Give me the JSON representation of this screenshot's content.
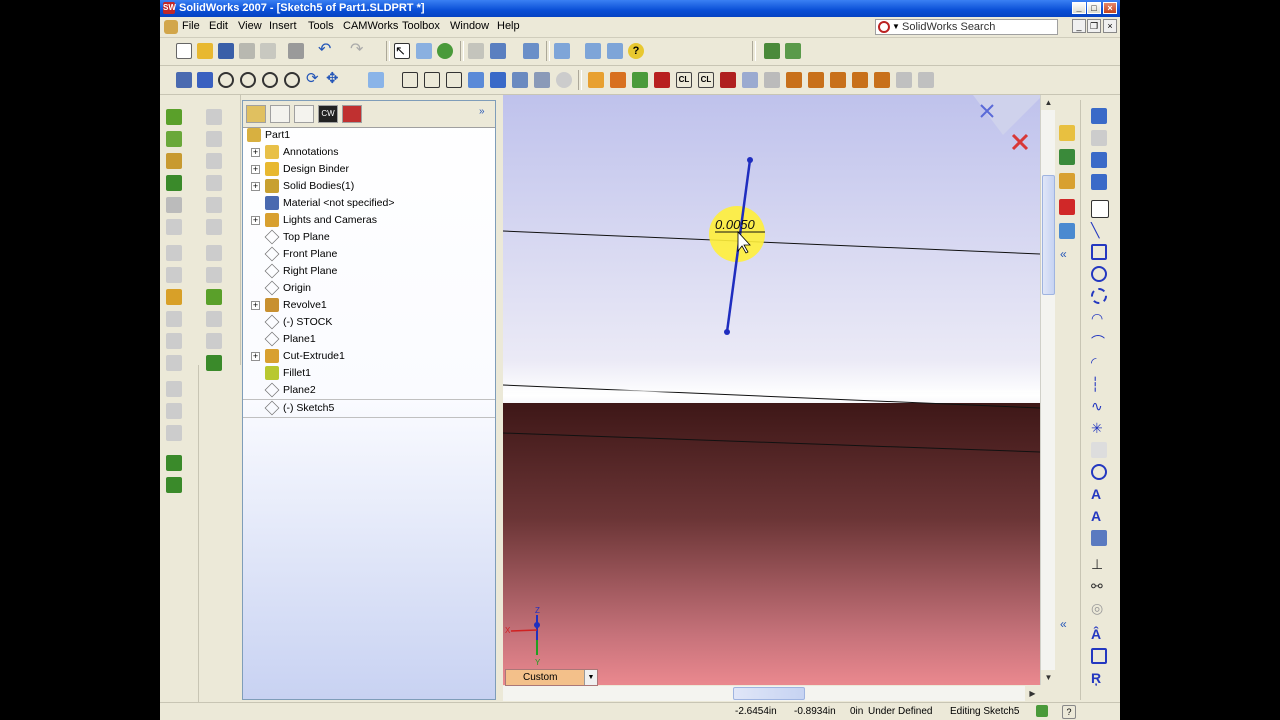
{
  "title": "SolidWorks 2007 - [Sketch5 of Part1.SLDPRT *]",
  "menu": [
    "File",
    "Edit",
    "View",
    "Insert",
    "Tools",
    "CAMWorks",
    "Toolbox",
    "Window",
    "Help"
  ],
  "search_label": "SolidWorks Search",
  "feature_tree": [
    {
      "label": "Part1",
      "icon": "part-icon",
      "expand": false,
      "indent": 0
    },
    {
      "label": "Annotations",
      "icon": "annotations-icon",
      "expand": true
    },
    {
      "label": "Design Binder",
      "icon": "design-binder-icon",
      "expand": true
    },
    {
      "label": "Solid Bodies(1)",
      "icon": "solid-bodies-icon",
      "expand": true
    },
    {
      "label": "Material <not specified>",
      "icon": "material-icon",
      "expand": false
    },
    {
      "label": "Lights and Cameras",
      "icon": "lights-icon",
      "expand": true
    },
    {
      "label": "Top Plane",
      "icon": "plane-icon",
      "expand": false
    },
    {
      "label": "Front Plane",
      "icon": "plane-icon",
      "expand": false
    },
    {
      "label": "Right Plane",
      "icon": "plane-icon",
      "expand": false
    },
    {
      "label": "Origin",
      "icon": "origin-icon",
      "expand": false
    },
    {
      "label": "Revolve1",
      "icon": "revolve-icon",
      "expand": true
    },
    {
      "label": "(-) STOCK",
      "icon": "sketch-icon",
      "expand": false
    },
    {
      "label": "Plane1",
      "icon": "plane-icon",
      "expand": false
    },
    {
      "label": "Cut-Extrude1",
      "icon": "cut-extrude-icon",
      "expand": true
    },
    {
      "label": "Fillet1",
      "icon": "fillet-icon",
      "expand": false
    },
    {
      "label": "Plane2",
      "icon": "plane-icon",
      "expand": false
    },
    {
      "label": "(-) Sketch5",
      "icon": "sketch-icon",
      "expand": false
    }
  ],
  "dimension_value": "0.0050",
  "view_combo": "Custom",
  "status": {
    "x": "-2.6454in",
    "y": "-0.8934in",
    "z": "0in",
    "state": "Under Defined",
    "mode": "Editing Sketch5"
  },
  "colors": {
    "accent": "#0a4fd6",
    "sketch_line": "#1f2dbf",
    "highlight": "#ffef3a",
    "part_body": "#6b3536"
  }
}
